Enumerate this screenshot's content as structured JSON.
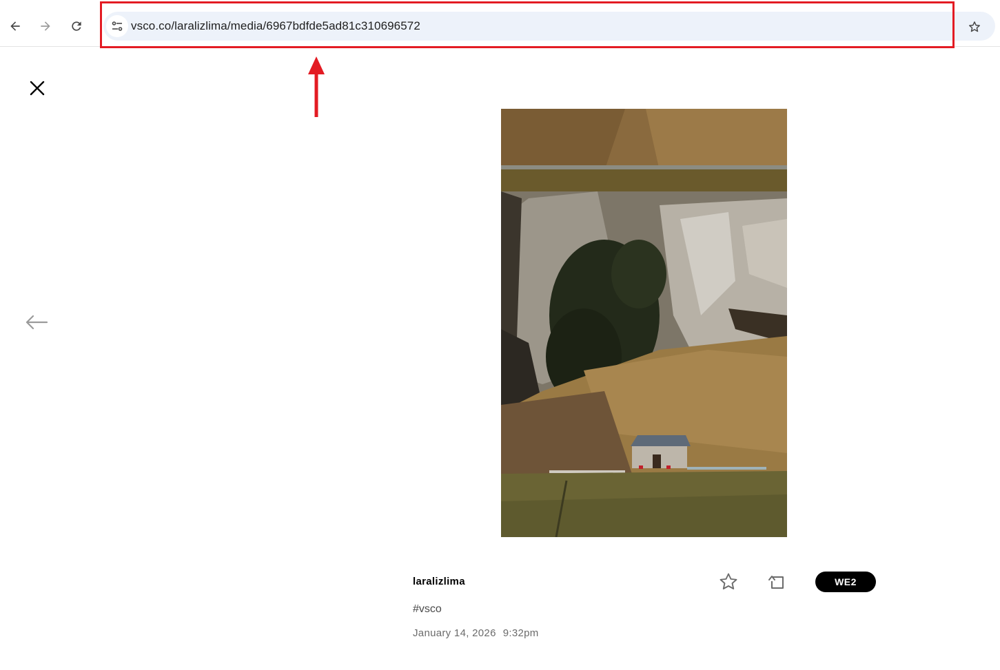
{
  "browser": {
    "url": "vsco.co/laralizlima/media/6967bdfde5ad81c310696572",
    "icons": {
      "back": "arrow-left-icon",
      "forward": "arrow-right-icon",
      "reload": "reload-icon",
      "site_info": "tune-icon",
      "bookmark": "star-outline-icon"
    }
  },
  "annotation": {
    "highlight_color": "#e31b23"
  },
  "viewer": {
    "icons": {
      "close": "close-icon",
      "previous": "arrow-left-icon"
    }
  },
  "post": {
    "username": "laralizlima",
    "caption": "#vsco",
    "date": "January 14, 2026",
    "time": "9:32pm",
    "preset": "WE2",
    "icons": {
      "favorite": "star-outline-icon",
      "repost": "repost-icon"
    }
  },
  "colors": {
    "omnibox_bg": "#edf2fa",
    "badge_bg": "#000000",
    "badge_text": "#ffffff"
  }
}
